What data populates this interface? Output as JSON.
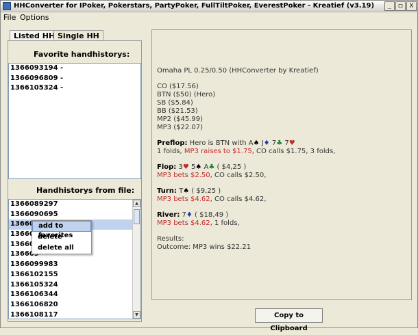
{
  "window": {
    "title": "HHConverter for IPoker, Pokerstars, PartyPoker, FullTiltPoker, EverestPoker - Kreatief (v3.19)",
    "min_glyph": "_",
    "max_glyph": "□",
    "close_glyph": "X"
  },
  "menu": {
    "file": "File",
    "options": "Options"
  },
  "tabs": {
    "listed": "Listed HHs",
    "single": "Single HH"
  },
  "favorites": {
    "label": "Favorite handhistorys:",
    "items": [
      "1366093194 -",
      "1366096809 -",
      "1366105324 -"
    ]
  },
  "file_list": {
    "label": "Handhistorys from file:",
    "items": [
      "1366089297",
      "1366090695",
      "136609",
      "136609",
      "136609",
      "136609",
      "1366099983",
      "1366102155",
      "1366105324",
      "1366106344",
      "1366106820",
      "1366108117",
      "1366109508"
    ]
  },
  "context_menu": {
    "add": "add to favorites",
    "delete": "delete",
    "delete_all": "delete all"
  },
  "hh": {
    "header": "Omaha PL 0.25/0.50 (HHConverter by Kreatief)",
    "seats": [
      "CO ($17.56)",
      "BTN ($50) (Hero)",
      "SB ($5.84)",
      "BB ($21.53)",
      "MP2 ($45.99)",
      "MP3 ($22.07)"
    ],
    "preflop_label": "Preflop:",
    "preflop_text": " Hero is BTN with A",
    "preflop_card2": " J",
    "preflop_card3": " 7",
    "preflop_card4": " 7",
    "preflop_action_a": "1 folds, ",
    "preflop_action_b": "MP3 raises to $1.75",
    "preflop_action_c": ", CO calls $1.75, 3 folds,",
    "flop_label": "Flop:",
    "flop_c1": " 3",
    "flop_c2": " 5",
    "flop_c3": " A",
    "flop_pot": " ( $4,25 )",
    "flop_action_a": "MP3 bets $2.50",
    "flop_action_b": ", CO calls $2.50,",
    "turn_label": "Turn:",
    "turn_c1": " T",
    "turn_pot": " ( $9,25 )",
    "turn_action_a": "MP3 bets $4.62",
    "turn_action_b": ", CO calls $4.62,",
    "river_label": "River:",
    "river_c1": " 7",
    "river_pot": " ( $18,49 )",
    "river_action_a": "MP3 bets $4.62",
    "river_action_b": ", 1 folds,",
    "results_label": "Results:",
    "outcome": "Outcome: MP3 wins $22.21",
    "suits": {
      "spade": "♠",
      "heart": "♥",
      "club": "♣",
      "diamond": "♦"
    }
  },
  "copy_button": "Copy to Clipboard",
  "colors": {
    "action_red": "#c32a2a",
    "selection": "#c1d2ee"
  }
}
